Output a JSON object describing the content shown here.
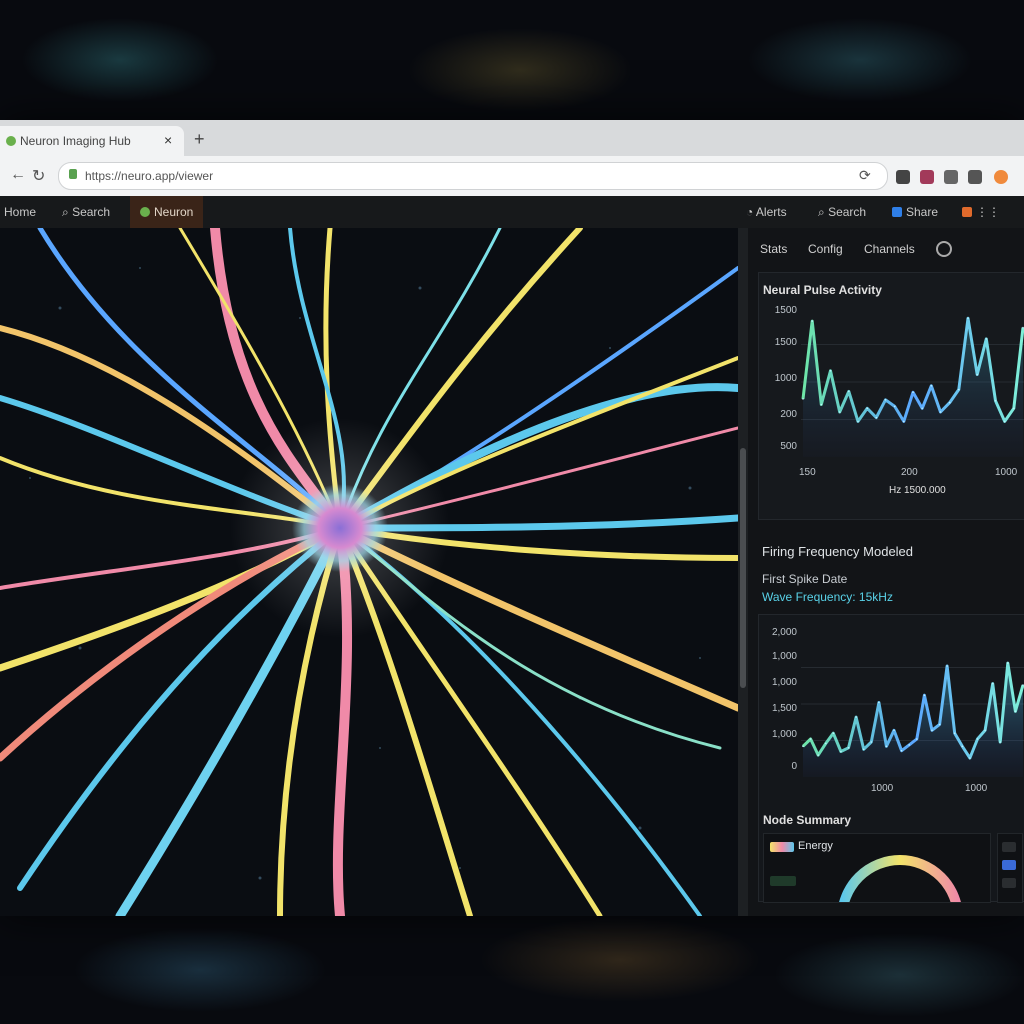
{
  "browser": {
    "tab_title": "Neuron Imaging Hub",
    "address": "https://neuro.app/viewer",
    "new_tab_symbol": "+",
    "close_symbol": "×",
    "back_symbol": "←",
    "reload_symbol": "↻",
    "refresh_symbol": "⟳"
  },
  "toolbar": {
    "left": [
      {
        "label": "Home"
      },
      {
        "label": "Search"
      },
      {
        "label": "Neuron"
      }
    ],
    "right": [
      {
        "label": "Alerts"
      },
      {
        "label": "Search"
      },
      {
        "label": "Share"
      }
    ]
  },
  "panel": {
    "tabs": [
      {
        "label": "Stats"
      },
      {
        "label": "Config"
      },
      {
        "label": "Channels"
      }
    ],
    "chart1": {
      "title": "Neural Pulse Activity",
      "yticks": [
        "1500",
        "1500",
        "1000",
        "200",
        "500"
      ],
      "xticks": [
        "150",
        "200",
        "1000"
      ],
      "footer": "Hz 1500.000"
    },
    "info_title": "Firing Frequency Modeled",
    "info_line1": "First Spike Date",
    "info_line2": "Wave Frequency: 15kHz",
    "chart2": {
      "yticks": [
        "2,000",
        "1,000",
        "1,000",
        "1,500",
        "1,000",
        "0"
      ],
      "xticks": [
        "1000",
        "1000"
      ]
    },
    "section3_title": "Node Summary",
    "legend_label": "Energy"
  },
  "colors": {
    "accent_cyan": "#4fd6e8",
    "accent_yellow": "#f2e36a",
    "accent_pink": "#f27aa8",
    "accent_blue": "#5aa6ff"
  },
  "chart_data": [
    {
      "type": "line",
      "title": "Neural Pulse Activity",
      "x": [
        0,
        1,
        2,
        3,
        4,
        5,
        6,
        7,
        8,
        9,
        10,
        11,
        12,
        13,
        14,
        15,
        16,
        17,
        18,
        19,
        20,
        21,
        22,
        23,
        24
      ],
      "series": [
        {
          "values": [
            620,
            1450,
            560,
            920,
            480,
            700,
            380,
            520,
            420,
            610,
            540,
            380,
            690,
            520,
            760,
            480,
            580,
            720,
            1480,
            880,
            1260,
            600,
            380,
            520,
            1380
          ]
        }
      ],
      "ylim": [
        0,
        1600
      ]
    },
    {
      "type": "area",
      "title": "",
      "x": [
        0,
        1,
        2,
        3,
        4,
        5,
        6,
        7,
        8,
        9,
        10,
        11,
        12,
        13,
        14,
        15,
        16,
        17,
        18,
        19,
        20,
        21,
        22,
        23,
        24,
        25,
        26,
        27,
        28,
        29
      ],
      "series": [
        {
          "values": [
            420,
            520,
            300,
            460,
            600,
            350,
            400,
            820,
            380,
            480,
            1020,
            420,
            640,
            360,
            440,
            520,
            1120,
            640,
            720,
            1520,
            600,
            420,
            260,
            520,
            640,
            1280,
            480,
            1560,
            900,
            1260
          ]
        }
      ],
      "ylim": [
        0,
        2000
      ]
    }
  ]
}
